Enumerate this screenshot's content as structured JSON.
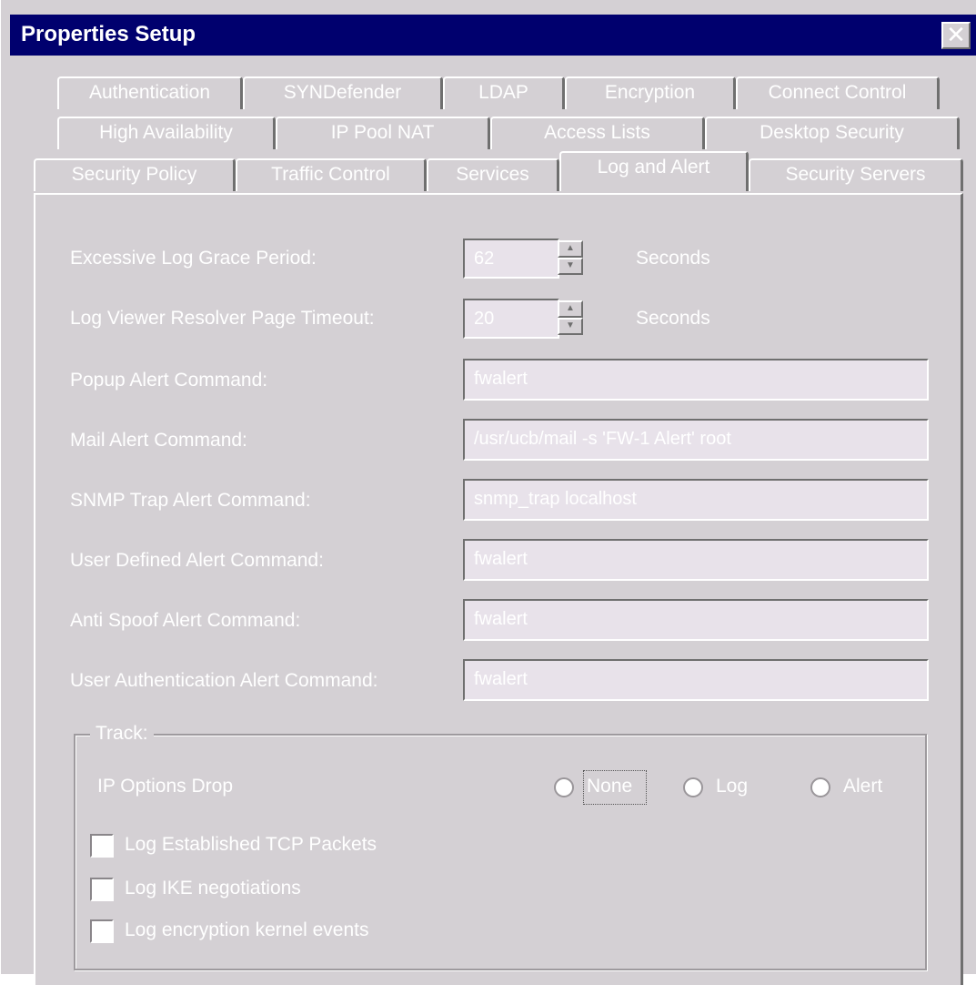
{
  "window": {
    "title": "Properties Setup",
    "close_glyph": "✕"
  },
  "tabs": {
    "row1": [
      "Authentication",
      "SYNDefender",
      "LDAP",
      "Encryption",
      "Connect Control"
    ],
    "row2": [
      "High Availability",
      "IP Pool NAT",
      "Access Lists",
      "Desktop Security"
    ],
    "row3": [
      "Security Policy",
      "Traffic Control",
      "Services",
      "Log and Alert",
      "Security Servers"
    ],
    "active": "Log and Alert"
  },
  "fields": {
    "excessive_log_grace_period": {
      "label": "Excessive Log Grace Period:",
      "value": "62",
      "unit": "Seconds"
    },
    "log_viewer_resolver_timeout": {
      "label": "Log Viewer Resolver Page Timeout:",
      "value": "20",
      "unit": "Seconds"
    },
    "popup_alert": {
      "label": "Popup Alert Command:",
      "value": "fwalert"
    },
    "mail_alert": {
      "label": "Mail Alert Command:",
      "value": "/usr/ucb/mail -s 'FW-1 Alert' root"
    },
    "snmp_trap_alert": {
      "label": "SNMP Trap Alert Command:",
      "value": "snmp_trap localhost"
    },
    "user_defined_alert": {
      "label": "User Defined Alert Command:",
      "value": "fwalert"
    },
    "anti_spoof_alert": {
      "label": "Anti Spoof Alert Command:",
      "value": "fwalert"
    },
    "user_auth_alert": {
      "label": "User Authentication Alert Command:",
      "value": "fwalert"
    }
  },
  "track": {
    "title": "Track:",
    "ip_options_label": "IP Options Drop",
    "radios": [
      "None",
      "Log",
      "Alert"
    ],
    "checkboxes": [
      "Log Established TCP Packets",
      "Log IKE negotiations",
      "Log encryption kernel events"
    ]
  },
  "colors": {
    "titlebar": "#00006e",
    "face": "#d4d0d4",
    "text": "#ffffff",
    "field_bg": "#e8e2ea"
  }
}
